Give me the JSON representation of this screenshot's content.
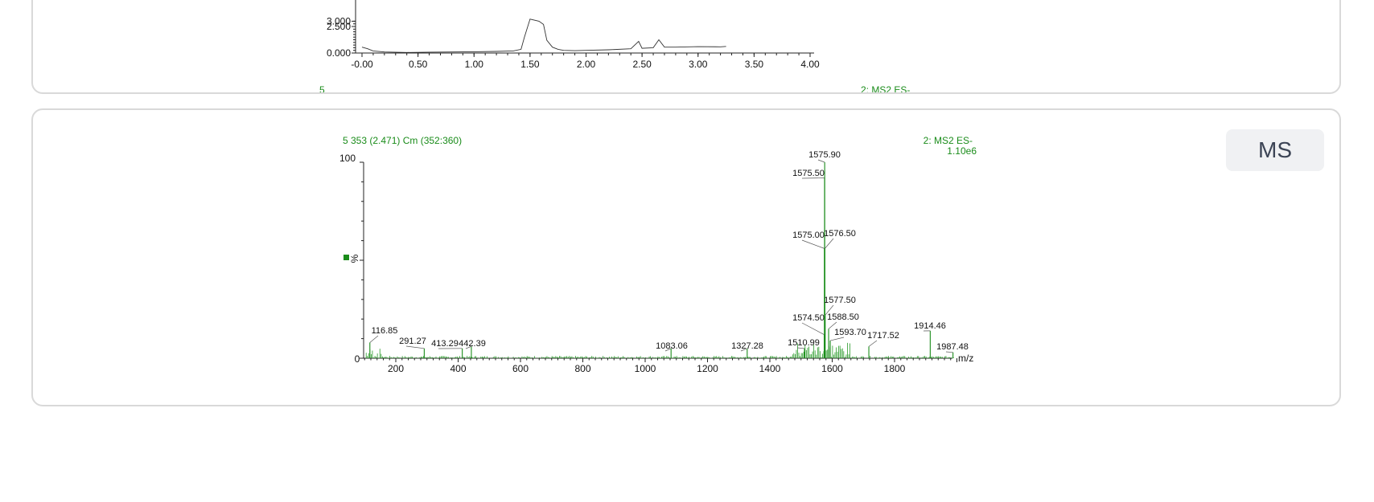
{
  "panels": {
    "chromatogram": {
      "y_tick_labels": [
        "3.000",
        "2.500",
        "0.000"
      ],
      "x_tick_labels": [
        "-0.00",
        "0.50",
        "1.00",
        "1.50",
        "2.00",
        "2.50",
        "3.00",
        "3.50",
        "4.00"
      ],
      "left_label_fragment": "5",
      "right_label_fragment": "2: MS2 ES-"
    },
    "ms": {
      "badge": "MS",
      "header_left": "5 353 (2.471) Cm (352:360)",
      "header_right_1": "2: MS2 ES-",
      "header_right_2": "1.10e6",
      "y_axis_label": "%",
      "y_tick_top": "100",
      "y_tick_bottom": "0",
      "x_axis_unit": "m/z"
    }
  },
  "chart_data": [
    {
      "type": "line",
      "title": "",
      "xlabel": "",
      "ylabel": "",
      "xlim": [
        -0.05,
        4.0
      ],
      "ylim": [
        0.0,
        3.0
      ],
      "series": [
        {
          "x": [
            0.0,
            0.05,
            0.1,
            0.2,
            0.4,
            0.6,
            0.8,
            1.0,
            1.2,
            1.35,
            1.42,
            1.45,
            1.5,
            1.58,
            1.62,
            1.65,
            1.7,
            1.75,
            1.8,
            1.9,
            2.0,
            2.2,
            2.4,
            2.47,
            2.5,
            2.6,
            2.65,
            2.7,
            2.8,
            3.0,
            3.2,
            3.25
          ],
          "y": [
            0.55,
            0.4,
            0.2,
            0.1,
            0.05,
            0.08,
            0.1,
            0.12,
            0.15,
            0.2,
            0.35,
            1.5,
            3.2,
            3.0,
            2.7,
            1.2,
            0.55,
            0.35,
            0.25,
            0.22,
            0.25,
            0.3,
            0.4,
            1.1,
            0.45,
            0.5,
            1.25,
            0.55,
            0.55,
            0.6,
            0.58,
            0.62
          ]
        }
      ]
    },
    {
      "type": "bar",
      "title": "5 353 (2.471) Cm (352:360)",
      "xlabel": "m/z",
      "ylabel": "%",
      "xlim": [
        100,
        2000
      ],
      "ylim": [
        0,
        100
      ],
      "x_ticks": [
        "200",
        "400",
        "600",
        "800",
        "1000",
        "1200",
        "1400",
        "1600",
        "1800"
      ],
      "x": [
        116.85,
        291.27,
        413.29,
        442.39,
        1083.06,
        1327.28,
        1510.99,
        1574.5,
        1575.0,
        1575.5,
        1575.9,
        1576.5,
        1577.5,
        1588.5,
        1593.7,
        1717.52,
        1914.46,
        1987.48
      ],
      "values": [
        8,
        5,
        5,
        6,
        5,
        5,
        5,
        12,
        56,
        92,
        100,
        56,
        22,
        15,
        9,
        6,
        14,
        3
      ],
      "labels": [
        "116.85",
        "291.27",
        "413.29",
        "442.39",
        "1083.06",
        "1327.28",
        "1510.99",
        "1574.50",
        "1575.00",
        "1575.50",
        "1575.90",
        "1576.50",
        "1577.50",
        "1588.50",
        "1593.70",
        "1717.52",
        "1914.46",
        "1987.48"
      ]
    }
  ]
}
